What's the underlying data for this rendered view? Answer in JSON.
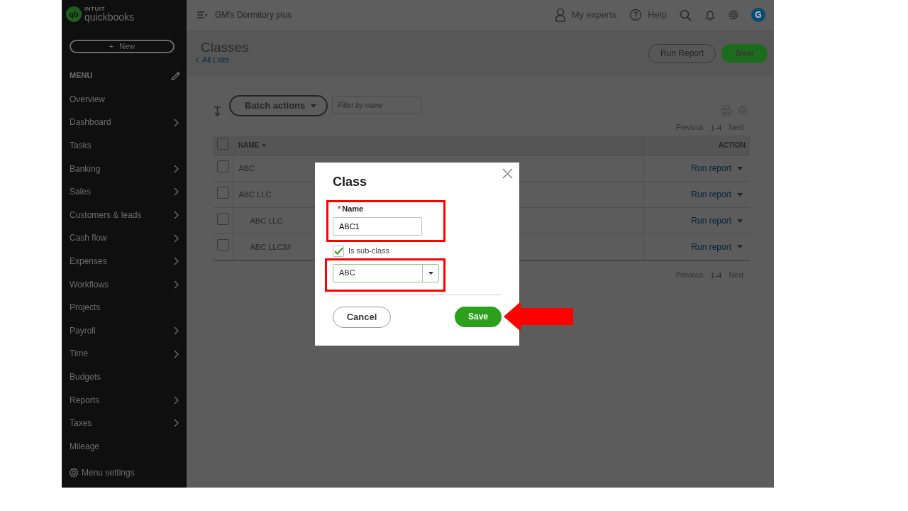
{
  "brand": {
    "top": "INTUIT",
    "name": "quickbooks",
    "mark": "qb"
  },
  "new_button": {
    "label": "New",
    "icon": "+"
  },
  "menu": {
    "heading": "MENU",
    "items": [
      {
        "label": "Overview",
        "has_submenu": false
      },
      {
        "label": "Dashboard",
        "has_submenu": true
      },
      {
        "label": "Tasks",
        "has_submenu": false
      },
      {
        "label": "Banking",
        "has_submenu": true
      },
      {
        "label": "Sales",
        "has_submenu": true
      },
      {
        "label": "Customers & leads",
        "has_submenu": true
      },
      {
        "label": "Cash flow",
        "has_submenu": true
      },
      {
        "label": "Expenses",
        "has_submenu": true
      },
      {
        "label": "Workflows",
        "has_submenu": true
      },
      {
        "label": "Projects",
        "has_submenu": false
      },
      {
        "label": "Payroll",
        "has_submenu": true
      },
      {
        "label": "Time",
        "has_submenu": true
      },
      {
        "label": "Budgets",
        "has_submenu": false
      },
      {
        "label": "Reports",
        "has_submenu": true
      },
      {
        "label": "Taxes",
        "has_submenu": true
      },
      {
        "label": "Mileage",
        "has_submenu": false
      }
    ],
    "settings": "Menu settings"
  },
  "topbar": {
    "company": "GM's Dormitory plus",
    "experts": "My experts",
    "help": "Help",
    "avatar": "G"
  },
  "page": {
    "title": "Classes",
    "back_link": "All Lists",
    "buttons": [
      {
        "label": "Run Report",
        "kind": "outline"
      },
      {
        "label": "New",
        "kind": "primary"
      }
    ]
  },
  "toolbar": {
    "batch": "Batch actions",
    "filter_placeholder": "Filter by name"
  },
  "pagination": [
    {
      "previous": "Previous",
      "range": "1-4",
      "next": "Next"
    },
    {
      "previous": "Previous",
      "range": "1-4",
      "next": "Next"
    }
  ],
  "table": {
    "all_selected": false,
    "columns": [
      "NAME",
      "ACTION"
    ],
    "rows": [
      {
        "name": "ABC",
        "action": "Run report",
        "checked": false
      },
      {
        "name": "ABC LLC",
        "action": "Run report",
        "checked": false,
        "children": [
          {
            "name": "ABC LLC",
            "action": "Run report",
            "checked": false
          },
          {
            "name": "ABC LLC3#",
            "action": "Run report",
            "checked": false
          }
        ]
      }
    ]
  },
  "dialog": {
    "title": "Class",
    "name_label": "Name",
    "required_marker": "*",
    "name_value": "ABC1",
    "subclass_label": "Is sub-class",
    "subclass_checked": true,
    "parent_value": "ABC",
    "buttons": [
      {
        "label": "Cancel",
        "kind": "secondary"
      },
      {
        "label": "Save",
        "kind": "primary"
      }
    ]
  },
  "annotations": [
    {
      "kind": "box"
    },
    {
      "kind": "box"
    },
    {
      "kind": "arrow"
    }
  ]
}
